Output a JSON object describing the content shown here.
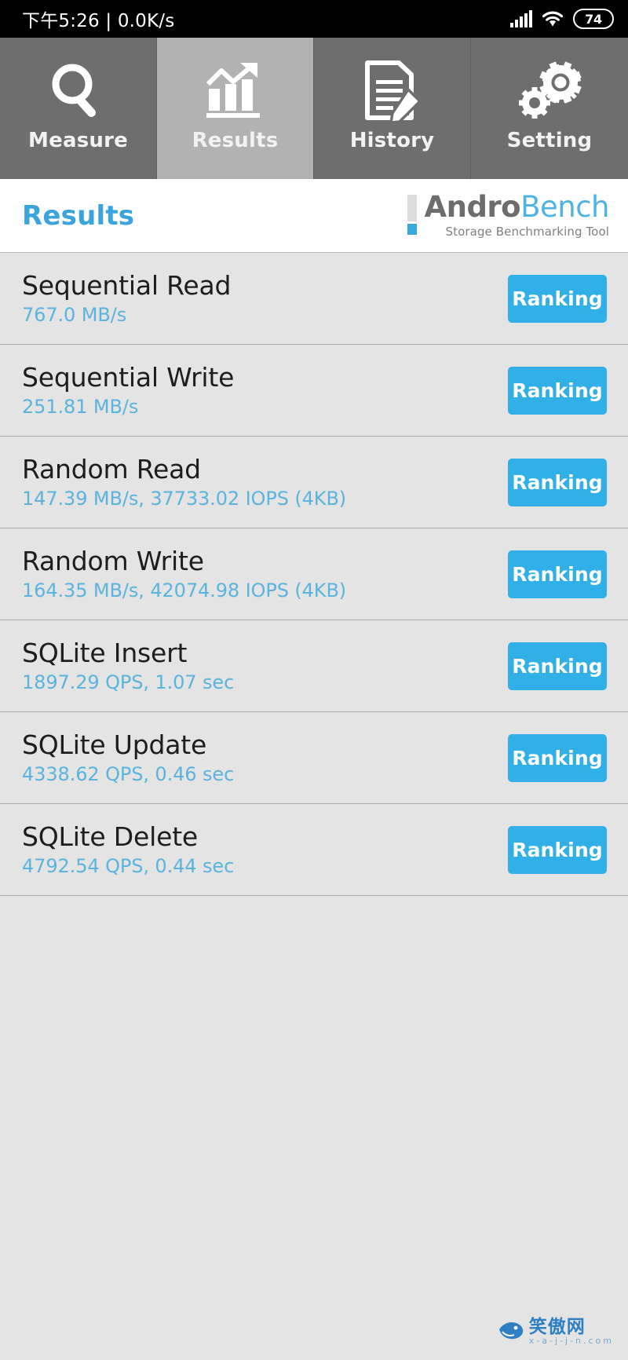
{
  "status_bar": {
    "time_text": "下午5:26 | 0.0K/s",
    "signal_icon": "signal-bars-icon",
    "wifi_icon": "wifi-icon",
    "battery_level": "74"
  },
  "tabs": [
    {
      "label": "Measure",
      "icon": "magnifier-icon",
      "active": false
    },
    {
      "label": "Results",
      "icon": "bar-chart-arrow-icon",
      "active": true
    },
    {
      "label": "History",
      "icon": "document-pencil-icon",
      "active": false
    },
    {
      "label": "Setting",
      "icon": "gears-icon",
      "active": false
    }
  ],
  "header": {
    "title": "Results",
    "logo_andro": "Andro",
    "logo_bench": "Bench",
    "logo_subtitle": "Storage Benchmarking Tool"
  },
  "results": [
    {
      "title": "Sequential Read",
      "value": "767.0 MB/s",
      "button": "Ranking"
    },
    {
      "title": "Sequential Write",
      "value": "251.81 MB/s",
      "button": "Ranking"
    },
    {
      "title": "Random Read",
      "value": "147.39 MB/s, 37733.02 IOPS (4KB)",
      "button": "Ranking"
    },
    {
      "title": "Random Write",
      "value": "164.35 MB/s, 42074.98 IOPS (4KB)",
      "button": "Ranking"
    },
    {
      "title": "SQLite Insert",
      "value": "1897.29 QPS, 1.07 sec",
      "button": "Ranking"
    },
    {
      "title": "SQLite Update",
      "value": "4338.62 QPS, 0.46 sec",
      "button": "Ranking"
    },
    {
      "title": "SQLite Delete",
      "value": "4792.54 QPS, 0.44 sec",
      "button": "Ranking"
    }
  ],
  "watermark": {
    "main": "笑傲网",
    "sub": "x-a-j-j-n.com"
  },
  "colors": {
    "accent_blue": "#31b0e8",
    "value_blue": "#5ab4dd",
    "title_blue": "#3aa5dc",
    "tab_inactive": "#6e6e6e",
    "tab_active": "#b2b2b2",
    "row_bg": "#e4e4e4"
  }
}
